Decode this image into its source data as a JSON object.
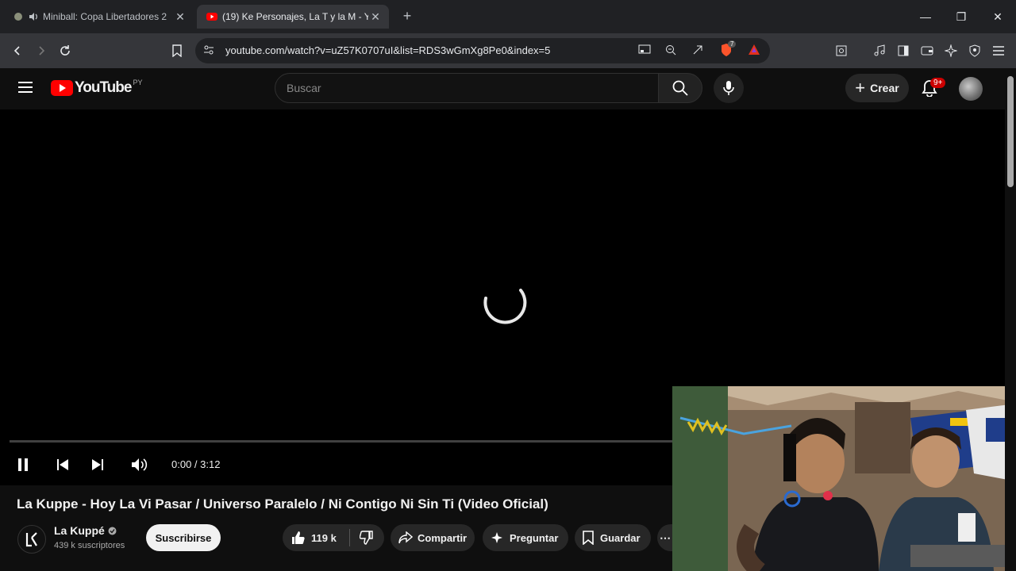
{
  "browser": {
    "tabs": [
      {
        "title": "Miniball: Copa Libertadores 2",
        "active": false
      },
      {
        "title": "(19) Ke Personajes, La T y la M - Y",
        "active": true
      }
    ],
    "url": "youtube.com/watch?v=uZ57K0707uI&list=RDS3wGmXg8Pe0&index=5",
    "extension_badge": "7"
  },
  "youtube": {
    "logo_text": "YouTube",
    "region": "PY",
    "search_placeholder": "Buscar",
    "create_label": "Crear",
    "notifications_badge": "9+"
  },
  "player": {
    "time": "0:00 / 3:12",
    "progress": 0
  },
  "video": {
    "title": "La Kuppe - Hoy La Vi Pasar / Universo Paralelo / Ni Contigo Ni Sin Ti (Video Oficial)",
    "channel_name": "La Kuppé",
    "subscribers": "439 k suscriptores",
    "subscribe_label": "Suscribirse",
    "likes": "119 k",
    "share_label": "Compartir",
    "ask_label": "Preguntar",
    "save_label": "Guardar"
  },
  "colors": {
    "accent": "#ff0000",
    "tab_bg": "#202124",
    "toolbar_bg": "#35363a",
    "page_bg": "#0f0f0f"
  }
}
